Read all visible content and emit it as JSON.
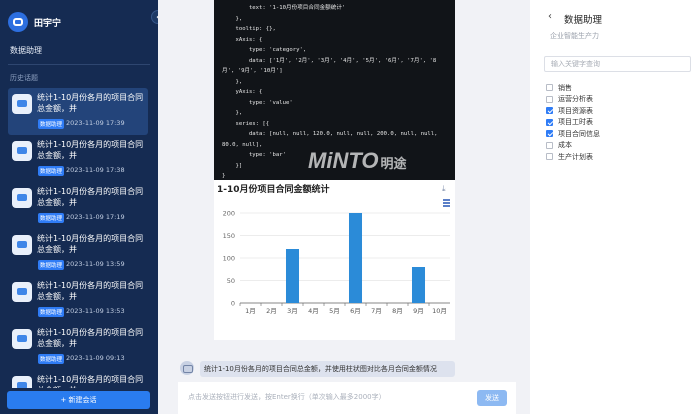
{
  "sidebar": {
    "user_name": "田宇宁",
    "title": "数据助理",
    "section_label": "历史话题",
    "collapse_glyph": "‹",
    "conversations": [
      {
        "title": "统计1-10月份各月的项目合同总金额，并",
        "tag": "数据助理",
        "time": "2023-11-09 17:39",
        "active": true
      },
      {
        "title": "统计1-10月份各月的项目合同总金额，并",
        "tag": "数据助理",
        "time": "2023-11-09 17:38",
        "active": false
      },
      {
        "title": "统计1-10月份各月的项目合同总金额，并",
        "tag": "数据助理",
        "time": "2023-11-09 17:19",
        "active": false
      },
      {
        "title": "统计1-10月份各月的项目合同总金额，并",
        "tag": "数据助理",
        "time": "2023-11-09 13:59",
        "active": false
      },
      {
        "title": "统计1-10月份各月的项目合同总金额，并",
        "tag": "数据助理",
        "time": "2023-11-09 13:53",
        "active": false
      },
      {
        "title": "统计1-10月份各月的项目合同总金额，并",
        "tag": "数据助理",
        "time": "2023-11-09 09:13",
        "active": false
      },
      {
        "title": "统计1-10月份各月的项目合同总金额，并",
        "tag": "数据助理",
        "time": "",
        "active": false
      }
    ],
    "new_chat_label": "+ 新建会话"
  },
  "code_block": {
    "lines": [
      "        text: '1-10月份项目合同金额统计'",
      "    },",
      "    tooltip: {},",
      "    xAxis: {",
      "        type: 'category',",
      "        data: ['1月', '2月', '3月', '4月', '5月', '6月', '7月', '8",
      "月', '9月', '10月']",
      "    },",
      "    yAxis: {",
      "        type: 'value'",
      "    },",
      "    series: [{",
      "        data: [null, null, 120.0, null, null, 200.0, null, null,",
      "80.0, null],",
      "        type: 'bar'",
      "    }]",
      "}"
    ],
    "watermark": "MiNTO",
    "watermark_cn": "明途"
  },
  "chart_data": {
    "type": "bar",
    "title": "1-10月份项目合同金额统计",
    "categories": [
      "1月",
      "2月",
      "3月",
      "4月",
      "5月",
      "6月",
      "7月",
      "8月",
      "9月",
      "10月"
    ],
    "values": [
      null,
      null,
      120,
      null,
      null,
      200,
      null,
      null,
      80,
      null
    ],
    "yticks": [
      0,
      50,
      100,
      150,
      200
    ],
    "ylim": [
      0,
      200
    ],
    "bar_color": "#2b8bd8",
    "grid": true
  },
  "chat": {
    "user_query": "统计1-10月份各月的项目合同总金额，并使用柱状图对比各月合同金额情况",
    "input_placeholder": "点击发送按钮进行发送，按Enter换行（单次输入最多2000字）",
    "send_label": "发送"
  },
  "right_panel": {
    "back_glyph": "‹",
    "title": "数据助理",
    "subtitle": "企业智能生产力",
    "search_placeholder": "输入关键字查询",
    "tables": [
      {
        "name": "销售",
        "checked": false
      },
      {
        "name": "运营分析表",
        "checked": false
      },
      {
        "name": "项目资源表",
        "checked": true
      },
      {
        "name": "项目工时表",
        "checked": true
      },
      {
        "name": "项目合同信息",
        "checked": true
      },
      {
        "name": "成本",
        "checked": false
      },
      {
        "name": "生产计划表",
        "checked": false
      }
    ]
  },
  "colors": {
    "sidebar_bg": "#152b52",
    "accent": "#2f7cf6"
  }
}
